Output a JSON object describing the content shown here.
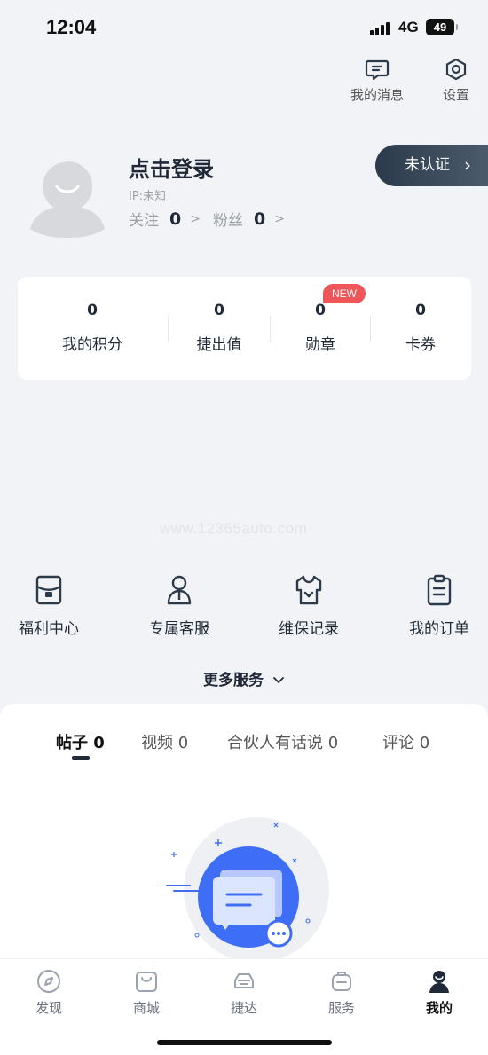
{
  "status_bar": {
    "time": "12:04",
    "network": "4G",
    "battery": "49"
  },
  "top_actions": {
    "messages": "我的消息",
    "settings": "设置"
  },
  "profile": {
    "login_prompt": "点击登录",
    "ip": "IP:未知",
    "follow_label": "关注",
    "follow_count": "0",
    "fans_label": "粉丝",
    "fans_count": "0",
    "verify_label": "未认证"
  },
  "stats": [
    {
      "value": "0",
      "label": "我的积分"
    },
    {
      "value": "0",
      "label": "捷出值"
    },
    {
      "value": "0",
      "label": "勋章",
      "badge": "NEW"
    },
    {
      "value": "0",
      "label": "卡券"
    }
  ],
  "watermark": "www.12365auto.com",
  "services": [
    {
      "label": "福利中心",
      "icon": "wallet-icon"
    },
    {
      "label": "专属客服",
      "icon": "agent-icon"
    },
    {
      "label": "维保记录",
      "icon": "shirt-icon"
    },
    {
      "label": "我的订单",
      "icon": "clipboard-icon"
    }
  ],
  "more_services": "更多服务",
  "tabs": [
    {
      "label": "帖子 0"
    },
    {
      "label": "视频 0"
    },
    {
      "label": "合伙人有话说 0"
    },
    {
      "label": "评论 0"
    }
  ],
  "bottom_nav": [
    {
      "label": "发现",
      "icon": "compass-icon"
    },
    {
      "label": "商城",
      "icon": "shopping-bag-icon"
    },
    {
      "label": "捷达",
      "icon": "car-icon"
    },
    {
      "label": "服务",
      "icon": "service-icon"
    },
    {
      "label": "我的",
      "icon": "profile-icon"
    }
  ],
  "colors": {
    "accent": "#2c3b4b",
    "badge": "#f0555a",
    "illustration": "#3d6ef5"
  }
}
